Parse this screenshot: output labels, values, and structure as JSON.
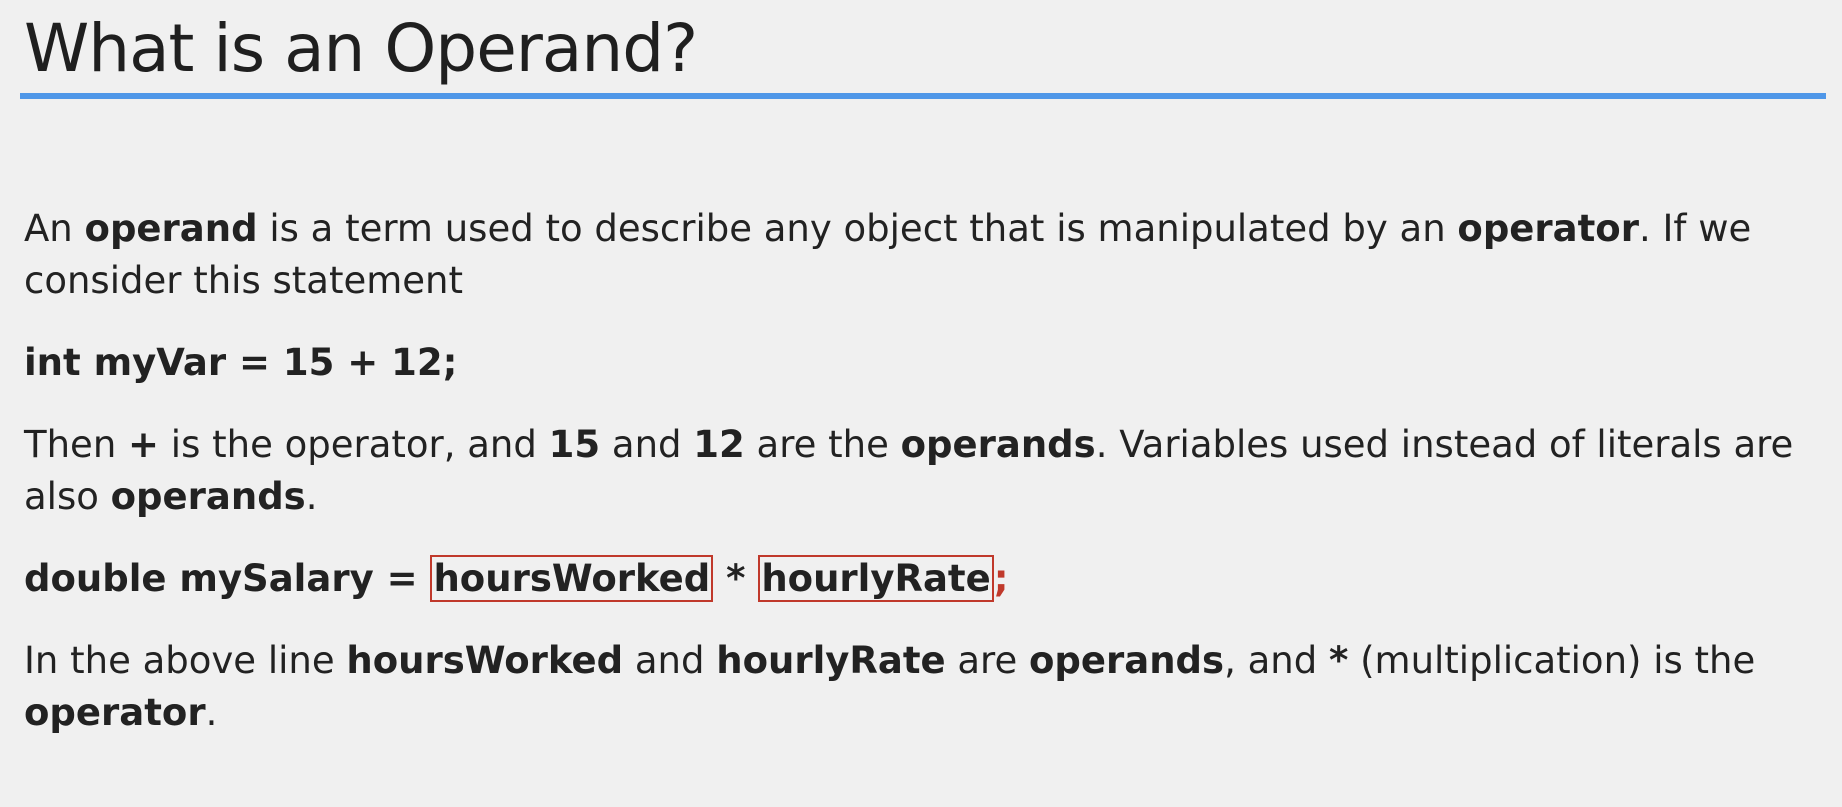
{
  "slide": {
    "title": "What is an Operand?",
    "p1": {
      "t1": "An ",
      "b1": "operand",
      "t2": " is a term used to describe any object that is manipulated by an ",
      "b2": "operator",
      "t3": ".  If we consider this statement"
    },
    "code1": "int myVar = 15 + 12;",
    "p2": {
      "t1": "Then ",
      "b1": "+",
      "t2": " is the operator, and ",
      "b2": "15",
      "t3": " and ",
      "b3": "12",
      "t4": " are the ",
      "b4": "operands",
      "t5": ".  Variables used instead of literals are also ",
      "b5": "operands",
      "t6": "."
    },
    "code2": {
      "prefix": "double mySalary = ",
      "operand1": "hoursWorked",
      "operator": " * ",
      "operand2": "hourlyRate",
      "suffix": ";"
    },
    "p3": {
      "t1": "In the above line ",
      "b1": "hoursWorked",
      "t2": " and ",
      "b2": "hourlyRate",
      "t3": " are ",
      "b3": "operands",
      "t4": ", and ",
      "b4": "*",
      "t5": " (multiplication) is the ",
      "b5": "operator",
      "t6": "."
    }
  },
  "colors": {
    "background": "#f0f0f0",
    "accent_rule": "#4f97e8",
    "highlight_box": "#c0392b",
    "text": "#222222"
  }
}
